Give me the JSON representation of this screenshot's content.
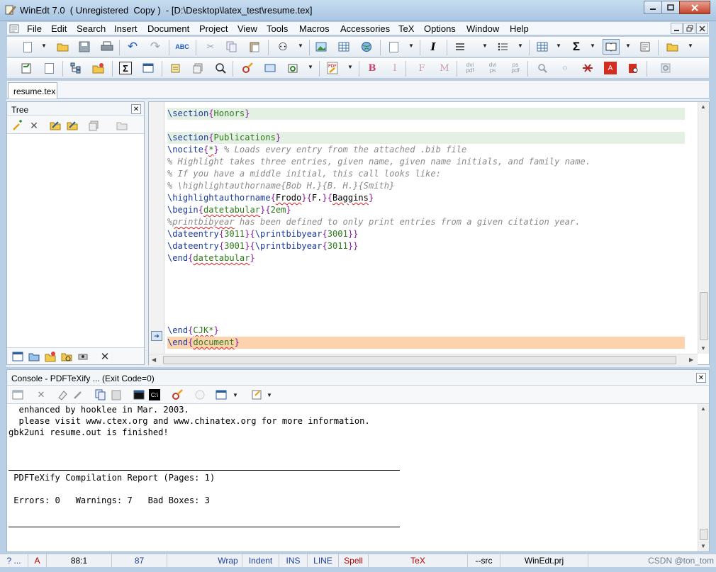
{
  "window": {
    "title": "WinEdt 7.0  ( Unregistered  Copy )  - [D:\\Desktop\\latex_test\\resume.tex]",
    "app_icon": "winedt-pen-icon",
    "controls": [
      "minimize",
      "maximize",
      "close"
    ]
  },
  "menu": {
    "items": [
      "File",
      "Edit",
      "Search",
      "Insert",
      "Document",
      "Project",
      "View",
      "Tools",
      "Macros",
      "Accessories",
      "TeX",
      "Options",
      "Window",
      "Help"
    ],
    "mdi_controls": [
      "minimize",
      "restore",
      "close"
    ]
  },
  "toolbar1": [
    "new-document-icon",
    "open-folder-icon",
    "save-icon",
    "print-icon",
    "undo-icon",
    "redo-icon",
    "spell-check-icon",
    "cut-icon",
    "copy-icon",
    "paste-icon",
    "find-binoculars-icon",
    "image-icon",
    "table-icon",
    "globe-icon",
    "document-icon",
    "italic-icon",
    "align-icon",
    "list-icon",
    "grid-icon",
    "sigma-icon",
    "book-icon",
    "note-icon",
    "folder-icon"
  ],
  "toolbar2": {
    "icons": [
      "tree-icon",
      "page-icon",
      "tree-structure-icon",
      "project-icon",
      "sigma-box-icon",
      "window-icon",
      "gather-icon",
      "stack-icon",
      "magnify-icon",
      "pen-search-icon",
      "frame-icon",
      "refresh-icon",
      "pdf-latex-icon"
    ],
    "text_buttons": [
      "B",
      "I",
      "F",
      "M"
    ],
    "conversions": [
      {
        "top": "dvi",
        "bottom": "pdf"
      },
      {
        "top": "dvi",
        "bottom": "ps"
      },
      {
        "top": "ps",
        "bottom": "pdf"
      }
    ],
    "tail_icons": [
      "search-dvi-icon",
      "dvi-icon",
      "bib-icon",
      "pdf-icon",
      "pdf-search-icon",
      "exit-icon"
    ]
  },
  "tabs": [
    {
      "label": "resume.tex",
      "active": true
    }
  ],
  "tree_panel": {
    "title": "Tree",
    "tools": [
      "add-tree-icon",
      "delete-icon",
      "folder-yellow-icon",
      "folder-yellow2-icon",
      "stack-gray-icon",
      "folder-open-icon"
    ],
    "bottom_tools": [
      "tree-view-icon",
      "folder-tree-icon",
      "project-tree-icon",
      "gather-tree-icon",
      "settings-tree-icon",
      "close-x-icon"
    ]
  },
  "editor": {
    "lines": [
      [
        {
          "t": "\\section",
          "c": "kw"
        },
        {
          "t": "{",
          "c": "br"
        },
        {
          "t": "Honors",
          "c": "arg"
        },
        {
          "t": "}",
          "c": "br"
        }
      ],
      [],
      [
        {
          "t": "\\section",
          "c": "kw"
        },
        {
          "t": "{",
          "c": "br"
        },
        {
          "t": "Publications",
          "c": "arg"
        },
        {
          "t": "}",
          "c": "br"
        }
      ],
      [
        {
          "t": "\\nocite",
          "c": "kw"
        },
        {
          "t": "{",
          "c": "br"
        },
        {
          "t": "*",
          "c": "arg sq"
        },
        {
          "t": "}",
          "c": "br"
        },
        {
          "t": " % Loads every entry from the attached .bib file",
          "c": "cm"
        }
      ],
      [
        {
          "t": "% Highlight takes three entries, given name, given name initials, and family name.",
          "c": "cm"
        }
      ],
      [
        {
          "t": "% If you have a middle initial, this call looks like:",
          "c": "cm"
        }
      ],
      [
        {
          "t": "% \\highlightauthorname{Bob H.}{B. H.}{Smith}",
          "c": "cm"
        }
      ],
      [
        {
          "t": "\\highlightauthorname",
          "c": "kw"
        },
        {
          "t": "{",
          "c": "br"
        },
        {
          "t": "Frodo",
          "c": "sq"
        },
        {
          "t": "}",
          "c": "br"
        },
        {
          "t": "{",
          "c": "br"
        },
        {
          "t": "F.",
          "c": ""
        },
        {
          "t": "}",
          "c": "br"
        },
        {
          "t": "{",
          "c": "br"
        },
        {
          "t": "Baggins",
          "c": "sq"
        },
        {
          "t": "}",
          "c": "br"
        }
      ],
      [
        {
          "t": "\\begin",
          "c": "kw"
        },
        {
          "t": "{",
          "c": "br"
        },
        {
          "t": "datetabular",
          "c": "arg sq"
        },
        {
          "t": "}",
          "c": "br"
        },
        {
          "t": "{",
          "c": "br"
        },
        {
          "t": "2em",
          "c": "arg"
        },
        {
          "t": "}",
          "c": "br"
        }
      ],
      [
        {
          "t": "%",
          "c": "cm"
        },
        {
          "t": "printbibyear",
          "c": "cm sq"
        },
        {
          "t": " has been defined to only print entries from a given citation year.",
          "c": "cm"
        }
      ],
      [
        {
          "t": "\\dateentry",
          "c": "kw"
        },
        {
          "t": "{",
          "c": "br"
        },
        {
          "t": "3011",
          "c": "arg"
        },
        {
          "t": "}",
          "c": "br"
        },
        {
          "t": "{",
          "c": "br"
        },
        {
          "t": "\\printbibyear",
          "c": "kw"
        },
        {
          "t": "{",
          "c": "br"
        },
        {
          "t": "3001",
          "c": "arg"
        },
        {
          "t": "}}",
          "c": "br"
        }
      ],
      [
        {
          "t": "\\dateentry",
          "c": "kw"
        },
        {
          "t": "{",
          "c": "br"
        },
        {
          "t": "3001",
          "c": "arg"
        },
        {
          "t": "}",
          "c": "br"
        },
        {
          "t": "{",
          "c": "br"
        },
        {
          "t": "\\printbibyear",
          "c": "kw"
        },
        {
          "t": "{",
          "c": "br"
        },
        {
          "t": "3011",
          "c": "arg"
        },
        {
          "t": "}}",
          "c": "br"
        }
      ],
      [
        {
          "t": "\\end",
          "c": "kw"
        },
        {
          "t": "{",
          "c": "br"
        },
        {
          "t": "datetabular",
          "c": "arg sq"
        },
        {
          "t": "}",
          "c": "br"
        }
      ],
      [],
      [],
      [],
      [],
      [],
      [
        {
          "t": "\\end",
          "c": "kw"
        },
        {
          "t": "{",
          "c": "br"
        },
        {
          "t": "CJK*",
          "c": "arg sq"
        },
        {
          "t": "}",
          "c": "br"
        }
      ],
      [
        {
          "t": "\\end",
          "c": "kw"
        },
        {
          "t": "{",
          "c": "br"
        },
        {
          "t": "document",
          "c": "arg sq"
        },
        {
          "t": "}",
          "c": "br"
        }
      ]
    ],
    "highlights": {
      "0": "green",
      "2": "green",
      "19": "orange"
    }
  },
  "console": {
    "title": "Console - PDFTeXify ...  (Exit Code=0)",
    "lines": [
      "  enhanced by hooklee in Mar. 2003.",
      "  please visit www.ctex.org and www.chinatex.org for more information.",
      "gbk2uni resume.out is finished!",
      "",
      "",
      "",
      " PDFTeXify Compilation Report (Pages: 1)",
      "",
      " Errors: 0   Warnings: 7   Bad Boxes: 3"
    ],
    "tools": [
      "console-window-icon",
      "clear-x-icon",
      "eraser-icon",
      "tools-icon",
      "copy-icon",
      "paste-icon",
      "terminal-icon",
      "cmd-icon",
      "pen-search-icon",
      "circle-icon",
      "window-drop-icon",
      "doc-drop-icon"
    ]
  },
  "statusbar": {
    "help": "? ...",
    "mode": "A",
    "position": "88:1",
    "lines_count": "87",
    "wrap": "Wrap",
    "indent": "Indent",
    "ins": "INS",
    "line": "LINE",
    "spell": "Spell",
    "tex": "TeX",
    "src": "--src",
    "project": "WinEdt.prj",
    "watermark": "CSDN @ton_tom"
  },
  "colors": {
    "keyword": "#1a3a9c",
    "brace": "#8a1b9e",
    "argument": "#2c7a18",
    "comment": "#8a8a8a",
    "highlight_green": "#e4f0e4",
    "highlight_orange": "#fdd3ae",
    "status_red": "#b30000",
    "status_blue": "#1d3f9a"
  }
}
